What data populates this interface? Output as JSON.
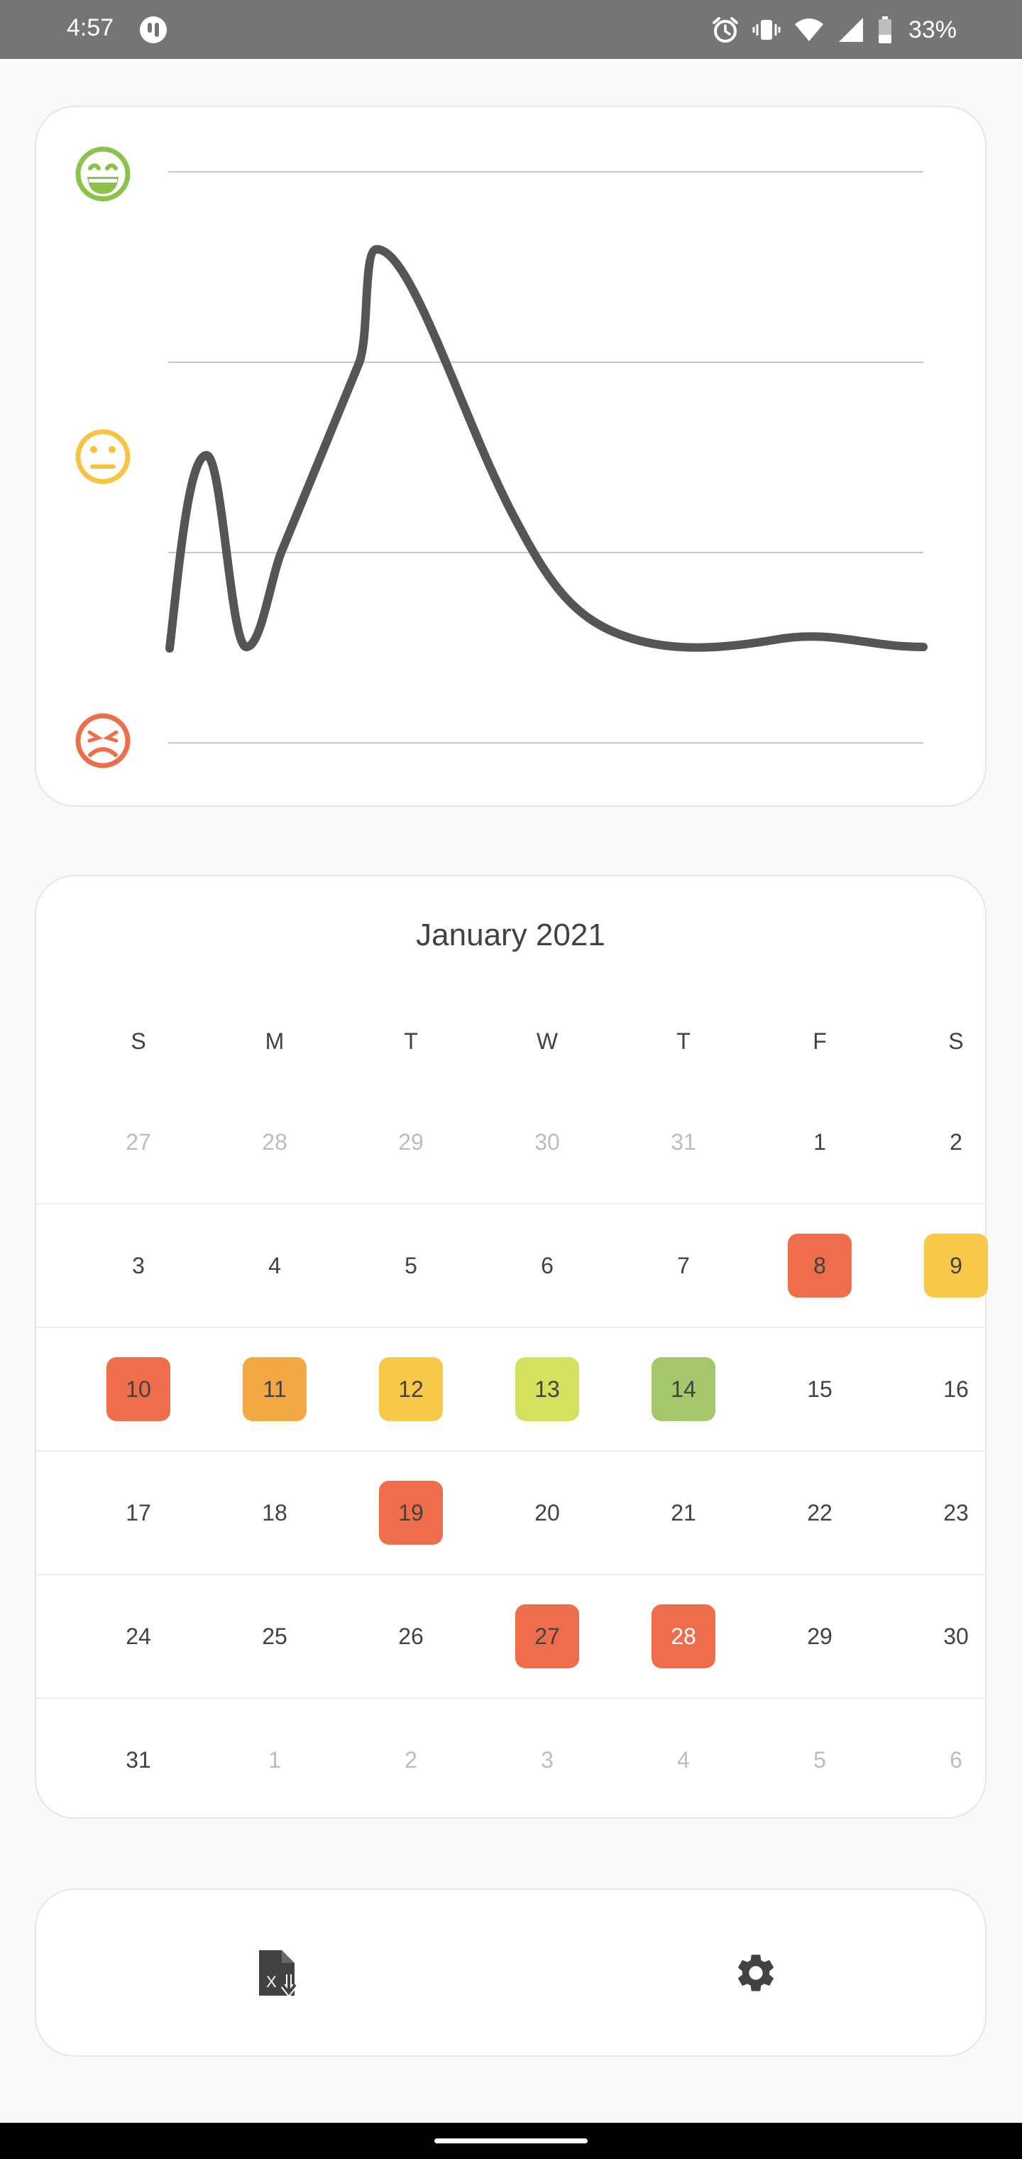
{
  "status_bar": {
    "time": "4:57",
    "battery": "33%",
    "icons": [
      "app-notification-icon",
      "alarm-icon",
      "vibrate-icon",
      "wifi-icon",
      "cell-signal-icon",
      "battery-icon"
    ]
  },
  "mood_chart": {
    "levels": [
      {
        "name": "happy",
        "icon": "grinning-face-icon",
        "color": "#8bc34a"
      },
      {
        "name": "neutral",
        "icon": "neutral-face-icon",
        "color": "#f6c343"
      },
      {
        "name": "sad",
        "icon": "sad-face-icon",
        "color": "#ee6e4b"
      }
    ],
    "line_color": "#555555"
  },
  "calendar": {
    "title": "January  2021",
    "weekdays": [
      "S",
      "M",
      "T",
      "W",
      "T",
      "F",
      "S"
    ],
    "weeks": [
      [
        {
          "d": "27",
          "m": true
        },
        {
          "d": "28",
          "m": true
        },
        {
          "d": "29",
          "m": true
        },
        {
          "d": "30",
          "m": true
        },
        {
          "d": "31",
          "m": true
        },
        {
          "d": "1"
        },
        {
          "d": "2"
        }
      ],
      [
        {
          "d": "3"
        },
        {
          "d": "4"
        },
        {
          "d": "5"
        },
        {
          "d": "6"
        },
        {
          "d": "7"
        },
        {
          "d": "8",
          "c": "#ee6e4b"
        },
        {
          "d": "9",
          "c": "#f6c94b"
        }
      ],
      [
        {
          "d": "10",
          "c": "#ee6e4b"
        },
        {
          "d": "11",
          "c": "#f3a843"
        },
        {
          "d": "12",
          "c": "#f6c94b"
        },
        {
          "d": "13",
          "c": "#d6e05f"
        },
        {
          "d": "14",
          "c": "#a5c76a"
        },
        {
          "d": "15"
        },
        {
          "d": "16"
        }
      ],
      [
        {
          "d": "17"
        },
        {
          "d": "18"
        },
        {
          "d": "19",
          "c": "#ee6e4b"
        },
        {
          "d": "20"
        },
        {
          "d": "21"
        },
        {
          "d": "22"
        },
        {
          "d": "23"
        }
      ],
      [
        {
          "d": "24"
        },
        {
          "d": "25"
        },
        {
          "d": "26"
        },
        {
          "d": "27",
          "c": "#ee6e4b"
        },
        {
          "d": "28",
          "c": "#ee6e4b",
          "light": true
        },
        {
          "d": "29"
        },
        {
          "d": "30"
        }
      ],
      [
        {
          "d": "31"
        },
        {
          "d": "1",
          "m": true
        },
        {
          "d": "2",
          "m": true
        },
        {
          "d": "3",
          "m": true
        },
        {
          "d": "4",
          "m": true
        },
        {
          "d": "5",
          "m": true
        },
        {
          "d": "6",
          "m": true
        }
      ]
    ]
  },
  "actions": {
    "export_icon": "excel-export-icon",
    "settings_icon": "gear-icon"
  }
}
